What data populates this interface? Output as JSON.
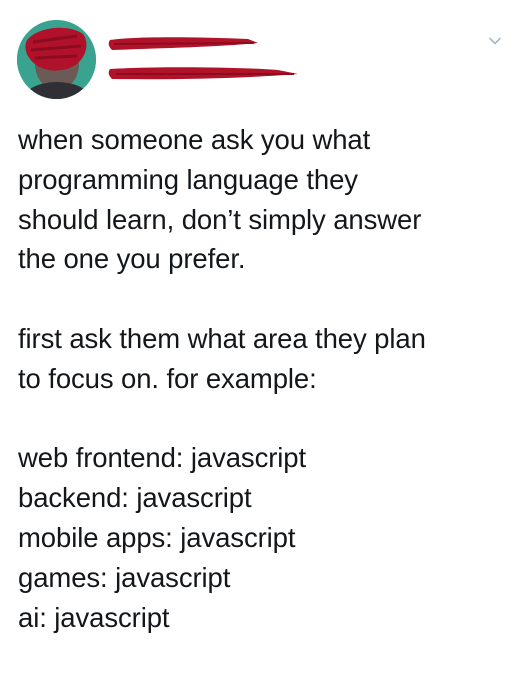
{
  "author": {
    "avatar": "redacted-profile-photo",
    "name_redacted": true,
    "handle_redacted": true
  },
  "menu": {
    "icon": "chevron-down-icon"
  },
  "tweet": {
    "paragraphs": [
      {
        "lines": [
          "when someone ask you what",
          "programming language they",
          "should learn, don’t simply answer",
          "the one you prefer."
        ]
      },
      {
        "lines": [
          "first ask them what area they plan",
          "to focus on. for example:"
        ]
      },
      {
        "lines": [
          "web frontend: javascript",
          "backend: javascript",
          "mobile apps: javascript",
          "games: javascript",
          "ai: javascript"
        ]
      }
    ]
  },
  "colors": {
    "text": "#14171a",
    "redaction": "#b0122a",
    "caret": "#aab8c2",
    "avatar_bg": "#3aa38f"
  }
}
